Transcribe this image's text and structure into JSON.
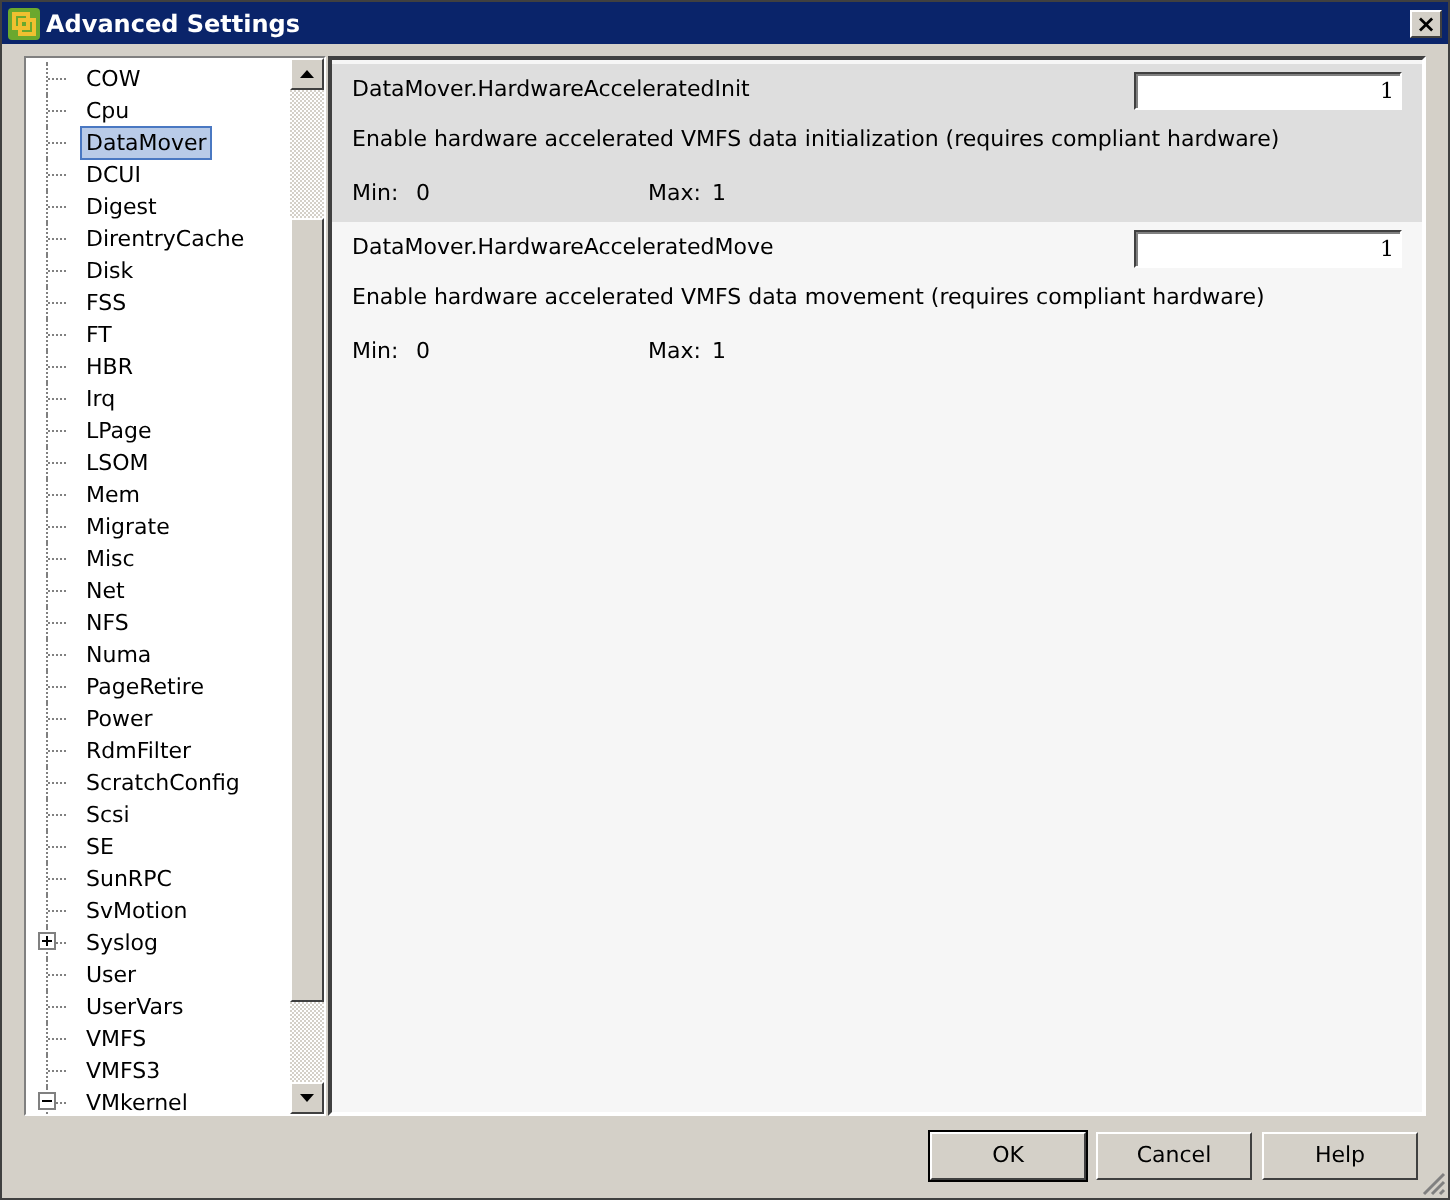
{
  "window": {
    "title": "Advanced Settings",
    "close": "×"
  },
  "tree": {
    "items": [
      {
        "label": "COW",
        "kind": "leaf",
        "selected": false
      },
      {
        "label": "Cpu",
        "kind": "leaf",
        "selected": false
      },
      {
        "label": "DataMover",
        "kind": "leaf",
        "selected": true
      },
      {
        "label": "DCUI",
        "kind": "leaf",
        "selected": false
      },
      {
        "label": "Digest",
        "kind": "leaf",
        "selected": false
      },
      {
        "label": "DirentryCache",
        "kind": "leaf",
        "selected": false
      },
      {
        "label": "Disk",
        "kind": "leaf",
        "selected": false
      },
      {
        "label": "FSS",
        "kind": "leaf",
        "selected": false
      },
      {
        "label": "FT",
        "kind": "leaf",
        "selected": false
      },
      {
        "label": "HBR",
        "kind": "leaf",
        "selected": false
      },
      {
        "label": "Irq",
        "kind": "leaf",
        "selected": false
      },
      {
        "label": "LPage",
        "kind": "leaf",
        "selected": false
      },
      {
        "label": "LSOM",
        "kind": "leaf",
        "selected": false
      },
      {
        "label": "Mem",
        "kind": "leaf",
        "selected": false
      },
      {
        "label": "Migrate",
        "kind": "leaf",
        "selected": false
      },
      {
        "label": "Misc",
        "kind": "leaf",
        "selected": false
      },
      {
        "label": "Net",
        "kind": "leaf",
        "selected": false
      },
      {
        "label": "NFS",
        "kind": "leaf",
        "selected": false
      },
      {
        "label": "Numa",
        "kind": "leaf",
        "selected": false
      },
      {
        "label": "PageRetire",
        "kind": "leaf",
        "selected": false
      },
      {
        "label": "Power",
        "kind": "leaf",
        "selected": false
      },
      {
        "label": "RdmFilter",
        "kind": "leaf",
        "selected": false
      },
      {
        "label": "ScratchConfig",
        "kind": "leaf",
        "selected": false
      },
      {
        "label": "Scsi",
        "kind": "leaf",
        "selected": false
      },
      {
        "label": "SE",
        "kind": "leaf",
        "selected": false
      },
      {
        "label": "SunRPC",
        "kind": "leaf",
        "selected": false
      },
      {
        "label": "SvMotion",
        "kind": "leaf",
        "selected": false
      },
      {
        "label": "Syslog",
        "kind": "group",
        "expanded": false,
        "selected": false
      },
      {
        "label": "User",
        "kind": "leaf",
        "selected": false
      },
      {
        "label": "UserVars",
        "kind": "leaf",
        "selected": false
      },
      {
        "label": "VMFS",
        "kind": "leaf",
        "selected": false
      },
      {
        "label": "VMFS3",
        "kind": "leaf",
        "selected": false
      },
      {
        "label": "VMkernel",
        "kind": "group",
        "expanded": true,
        "selected": false
      }
    ]
  },
  "settings": [
    {
      "name": "DataMover.HardwareAcceleratedInit",
      "value": "1",
      "description": "Enable hardware accelerated VMFS data initialization (requires compliant hardware)",
      "min_label": "Min:",
      "min": "0",
      "max_label": "Max:",
      "max": "1",
      "selected": true
    },
    {
      "name": "DataMover.HardwareAcceleratedMove",
      "value": "1",
      "description": "Enable hardware accelerated VMFS data movement (requires compliant hardware)",
      "min_label": "Min:",
      "min": "0",
      "max_label": "Max:",
      "max": "1",
      "selected": false
    }
  ],
  "buttons": [
    {
      "label": "OK",
      "default": true
    },
    {
      "label": "Cancel",
      "default": false
    },
    {
      "label": "Help",
      "default": false
    }
  ]
}
